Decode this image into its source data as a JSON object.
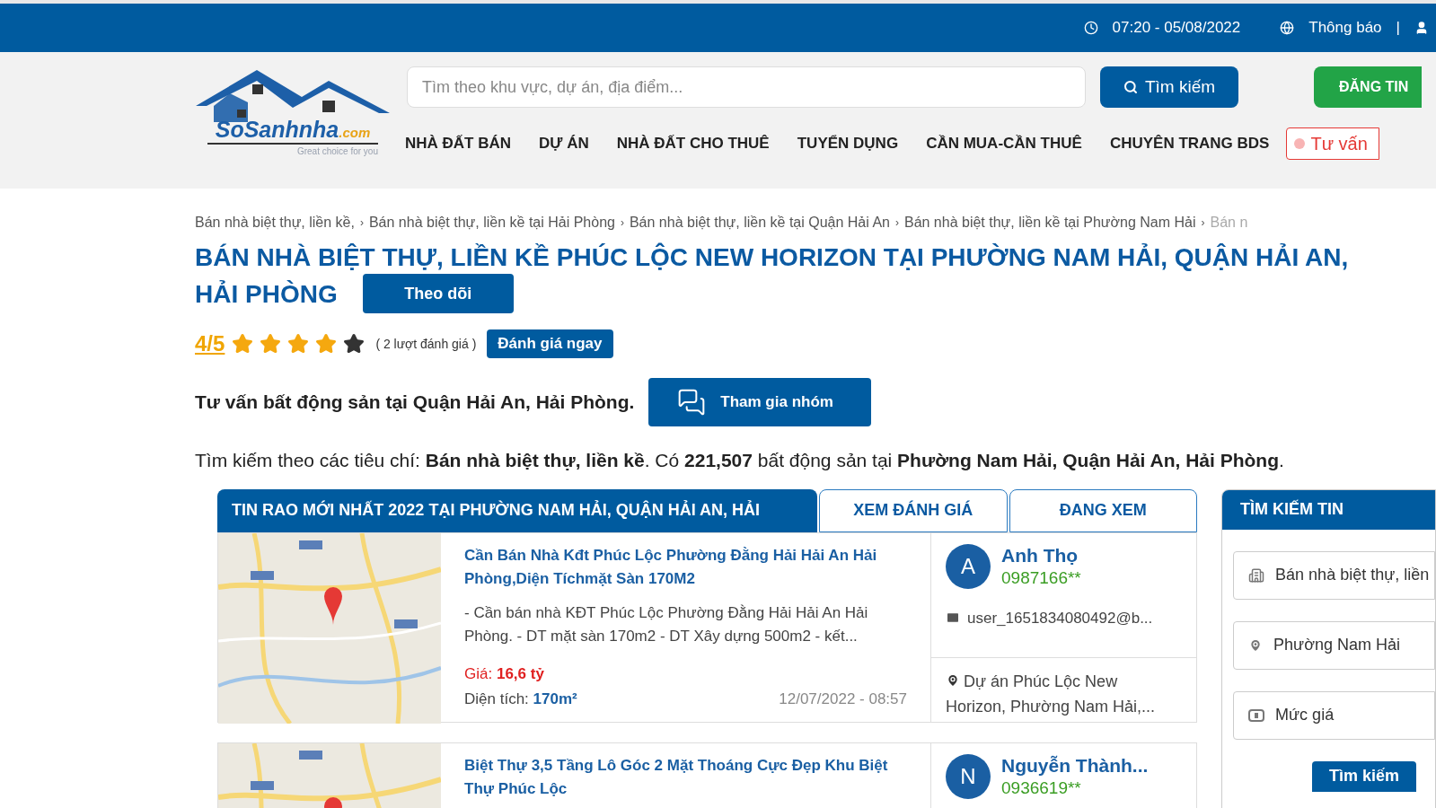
{
  "topbar": {
    "datetime": "07:20 - 05/08/2022",
    "notice": "Thông báo",
    "separator": "|"
  },
  "header": {
    "logo": {
      "name": "SoSanhnha",
      "tld": ".com",
      "tagline": "Great choice for you"
    },
    "search_placeholder": "Tìm theo khu vực, dự án, địa điểm...",
    "search_button": "Tìm kiếm",
    "post_button": "ĐĂNG TIN",
    "nav": [
      "NHÀ ĐẤT BÁN",
      "DỰ ÁN",
      "NHÀ ĐẤT CHO THUÊ",
      "TUYỂN DỤNG",
      "CẦN MUA-CẦN THUÊ",
      "CHUYÊN TRANG BDS"
    ],
    "consult_button": "Tư vấn"
  },
  "breadcrumbs": [
    {
      "label": "Bán nhà biệt thự, liền kề,",
      "separator": "›"
    },
    {
      "label": "Bán nhà biệt thự, liền kề tại Hải Phòng",
      "separator": "›"
    },
    {
      "label": "Bán nhà biệt thự, liền kề tại Quận Hải An",
      "separator": "›"
    },
    {
      "label": "Bán nhà biệt thự, liền kề tại Phường Nam Hải",
      "separator": "›"
    },
    {
      "label": "Bán n"
    }
  ],
  "title_lines": [
    "BÁN NHÀ BIỆT THỰ, LIỀN KỀ PHÚC LỘC NEW HORIZON TẠI PHƯỜNG NAM HẢI, QUẬN HẢI AN,",
    "HẢI PHÒNG"
  ],
  "follow_button": "Theo dõi",
  "rating": {
    "score": "4/5",
    "stars": 4,
    "count": "( 2 lượt đánh giá )",
    "button": "Đánh giá ngay"
  },
  "group": {
    "text": "Tư vấn bất động sản tại Quận Hải An, Hải Phòng.",
    "button": "Tham gia nhóm"
  },
  "summary": "Tìm kiếm theo các tiêu chí: **Bán nhà biệt thự, liền kề**. Có **221,507** bất động sản tại **Phường Nam Hải, Quận Hải An, Hải Phòng**.",
  "tabs": [
    {
      "label": "TIN RAO MỚI NHẤT 2022 TẠI PHƯỜNG NAM HẢI, QUẬN HẢI AN, HẢI",
      "selected": true
    },
    {
      "label": "XEM ĐÁNH GIÁ",
      "selected": false
    },
    {
      "label": "ĐANG XEM",
      "selected": false
    }
  ],
  "listings": [
    {
      "title": "Cần Bán Nhà Kđt Phúc Lộc Phường Đằng Hải Hải An Hải Phòng,Diện Tíchmặt Sàn 170M2",
      "description": "- Cần bán nhà KĐT Phúc Lộc Phường Đằng Hải Hải An Hải Phòng. - DT mặt sàn 170m2 - DT Xây dựng 500m2 - kết...",
      "price_label": "Giá:",
      "price": "16,6 tỷ",
      "area_label": "Diện tích:",
      "area": "170m²",
      "date": "12/07/2022 - 08:57",
      "agent": {
        "initial": "A",
        "name": "Anh Thọ",
        "phone": "0987166**",
        "email": "user_1651834080492@b..."
      },
      "location": "Dự án Phúc Lộc New Horizon, Phường Nam Hải,..."
    },
    {
      "title": "Biệt Thự 3,5 Tầng Lô Góc 2 Mặt Thoáng Cực Đẹp Khu Biệt Thự Phúc Lộc",
      "agent": {
        "initial": "N",
        "name": "Nguyễn Thành...",
        "phone": "0936619**"
      }
    }
  ],
  "sidebar": {
    "title": "TÌM KIẾM TIN",
    "fields": [
      {
        "kind": "type",
        "value": "Bán nhà biệt thự, liền"
      },
      {
        "kind": "location",
        "value": "Phường Nam Hải"
      },
      {
        "kind": "price",
        "value": "Mức giá"
      }
    ],
    "button": "Tìm kiếm"
  }
}
